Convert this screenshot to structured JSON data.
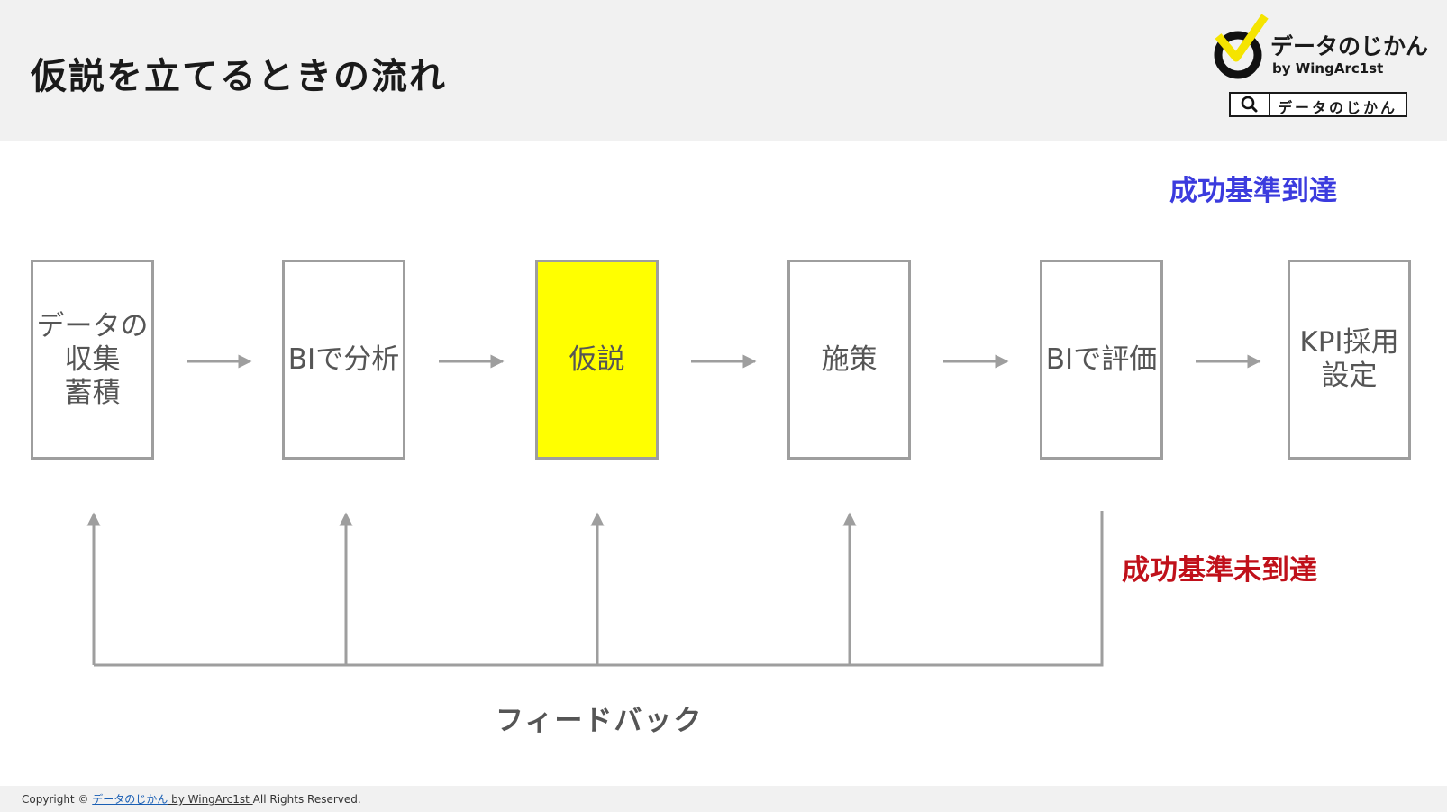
{
  "header": {
    "title": "仮説を立てるときの流れ",
    "logo": {
      "name": "データのじかん",
      "sub": "by WingArc1st",
      "icon": "check-circle-logo-icon",
      "accent_color": "#f5e400"
    },
    "search": {
      "icon": "search-icon",
      "text": "データのじかん"
    }
  },
  "flow": {
    "steps": [
      {
        "label": "データの\n収集\n蓄積",
        "active": false
      },
      {
        "label": "BIで分析",
        "active": false
      },
      {
        "label": "仮説",
        "active": true
      },
      {
        "label": "施策",
        "active": false
      },
      {
        "label": "BIで評価",
        "active": false
      },
      {
        "label": "KPI採用\n設定",
        "active": false
      }
    ],
    "success_label": "成功基準到達",
    "fail_label": "成功基準未到達",
    "feedback_label": "フィードバック",
    "colors": {
      "highlight": "#ffff00",
      "box_border": "#9e9e9e",
      "arrow": "#9e9e9e",
      "success": "#3b3bde",
      "fail": "#c0101a"
    }
  },
  "footer": {
    "prefix": "Copyright © ",
    "link": "データのじかん",
    "by": " by WingArc1st ",
    "suffix": "All Rights Reserved."
  }
}
